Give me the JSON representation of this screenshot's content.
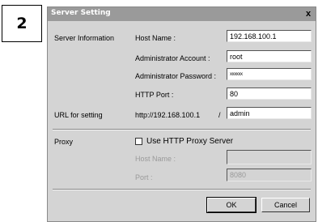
{
  "step_number": "2",
  "dialog": {
    "title": "Server Setting",
    "close_glyph": "x"
  },
  "server_information": {
    "section_label": "Server Information",
    "host_name_label": "Host Name :",
    "host_name_value": "192.168.100.1",
    "admin_account_label": "Administrator Account :",
    "admin_account_value": "root",
    "admin_password_label": "Administrator Password :",
    "admin_password_value": "xxxxxx",
    "http_port_label": "HTTP Port :",
    "http_port_value": "80"
  },
  "url_setting": {
    "section_label": "URL for setting",
    "prefix": "http://192.168.100.1",
    "separator": "/",
    "path_value": "admin"
  },
  "proxy": {
    "section_label": "Proxy",
    "use_proxy_label": "Use HTTP Proxy Server",
    "use_proxy_checked": false,
    "host_name_label": "Host Name :",
    "host_name_value": "",
    "port_label": "Port :",
    "port_value": "8080"
  },
  "buttons": {
    "ok_label": "OK",
    "cancel_label": "Cancel"
  }
}
